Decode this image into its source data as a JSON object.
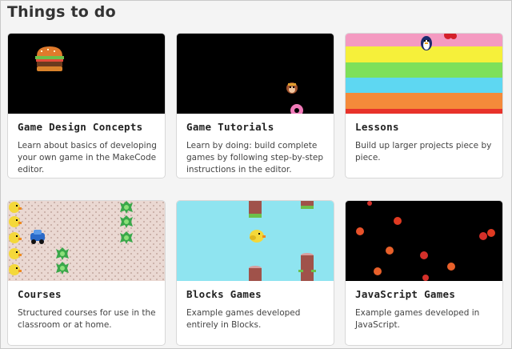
{
  "page": {
    "title": "Things to do"
  },
  "cards": [
    {
      "title": "Game Design Concepts",
      "description": "Learn about basics of developing your own game in the MakeCode editor."
    },
    {
      "title": "Game Tutorials",
      "description": "Learn by doing: build complete games by following step-by-step instructions in the editor."
    },
    {
      "title": "Lessons",
      "description": "Build up larger projects piece by piece."
    },
    {
      "title": "Courses",
      "description": "Structured courses for use in the classroom or at home."
    },
    {
      "title": "Blocks Games",
      "description": "Example games developed entirely in Blocks."
    },
    {
      "title": "JavaScript Games",
      "description": "Example games developed in JavaScript."
    }
  ],
  "icons": {
    "card1": "burger-sprite-icon",
    "card2": "monkey-and-donut-sprites-icon",
    "card3": "rainbow-stripes-penguin-icon",
    "card4": "duck-and-cactus-pattern-icon",
    "card5": "bird-and-logs-icon",
    "card6": "red-dots-icon"
  },
  "colors": {
    "background": "#f4f4f4",
    "card_bg": "#ffffff",
    "sky": "#8fe4f0",
    "black": "#000000"
  }
}
